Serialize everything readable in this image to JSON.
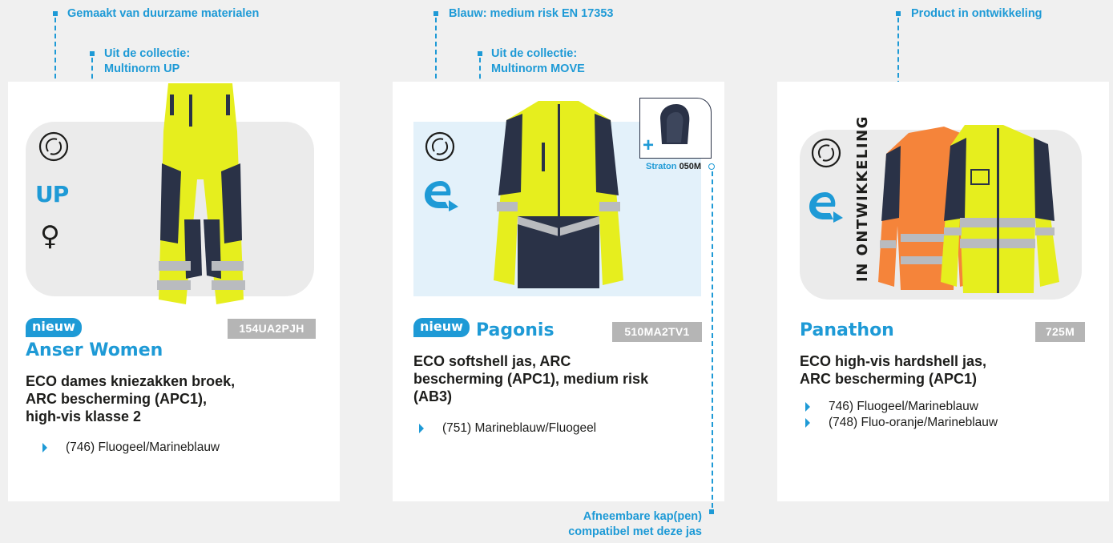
{
  "annotations": {
    "sustainable": "Gemaakt van duurzame materialen",
    "collection_up_line1": "Uit de collectie:",
    "collection_up_line2": "Multinorm UP",
    "medium_risk": "Blauw: medium risk EN 17353",
    "collection_move_line1": "Uit de collectie:",
    "collection_move_line2": "Multinorm MOVE",
    "in_development": "Product in ontwikkeling",
    "hood_line1": "Afneembare kap(pen)",
    "hood_line2": "compatibel met deze jas"
  },
  "products": [
    {
      "badge": "nieuw",
      "name": "Anser Women",
      "code": "154UA2PJH",
      "description": [
        "ECO dames kniezakken broek,",
        "ARC bescherming (APC1),",
        "high-vis klasse 2"
      ],
      "colors": [
        "(746) Fluogeel/Marineblauw"
      ]
    },
    {
      "badge": "nieuw",
      "name": "Pagonis",
      "code": "510MA2TV1",
      "description": [
        "ECO softshell jas, ARC",
        "bescherming (APC1), medium risk",
        "(AB3)"
      ],
      "colors": [
        "(751) Marineblauw/Fluogeel"
      ],
      "accessory": {
        "name": "Straton",
        "code": "050M",
        "plus": "+"
      }
    },
    {
      "name": "Panathon",
      "code": "725M",
      "status_vertical": "IN ONTWIKKELING",
      "description": [
        "ECO high-vis hardshell jas,",
        "ARC bescherming (APC1)"
      ],
      "colors": [
        "746) Fluogeel/Marineblauw",
        "(748) Fluo-oranje/Marineblauw"
      ]
    }
  ],
  "icons": {
    "collection_up_label": "UP",
    "female_symbol": "♀"
  },
  "colors": {
    "accent": "#1e9ad6",
    "hivis_yellow": "#e6ee1e",
    "navy": "#2a3247",
    "orange": "#f5843a",
    "code_grey": "#b5b5b5",
    "medium_risk_bg": "#e3f1fa"
  }
}
